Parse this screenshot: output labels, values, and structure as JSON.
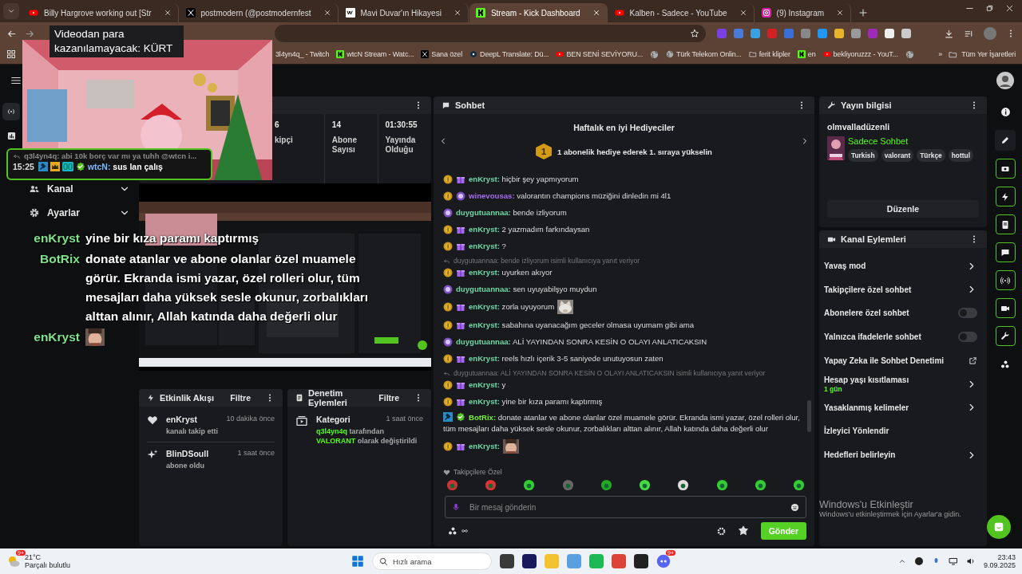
{
  "browser": {
    "tabs": [
      {
        "title": "Billy Hargrove working out [Str",
        "kind": "youtube",
        "selected": false
      },
      {
        "title": "postmodern (@postmodernfest",
        "kind": "x",
        "selected": false
      },
      {
        "title": "Mavi Duvar'ın Hikayesi",
        "kind": "wa",
        "selected": false
      },
      {
        "title": "Stream - Kick Dashboard",
        "kind": "kick",
        "selected": true
      },
      {
        "title": "Kalben - Sadece - YouTube",
        "kind": "youtube",
        "selected": false
      },
      {
        "title": "(9) Instagram",
        "kind": "instagram",
        "selected": false
      }
    ],
    "bookmarks": [
      {
        "label": "3l4yn4q_ - Twitch",
        "kind": "none"
      },
      {
        "label": "wtcN Stream - Watc...",
        "kind": "kick"
      },
      {
        "label": "Sana özel",
        "kind": "x"
      },
      {
        "label": "DeepL Translate: Dü...",
        "kind": "deepl"
      },
      {
        "label": "BEN SENİ SEVİYORU...",
        "kind": "youtube"
      },
      {
        "kind": "globe"
      },
      {
        "label": "Türk Telekom Onlin...",
        "kind": "globe"
      },
      {
        "label": "ferit klipler",
        "kind": "folder"
      },
      {
        "label": "en",
        "kind": "kick"
      },
      {
        "label": "bekliyoruzzz - YouT...",
        "kind": "youtube"
      },
      {
        "kind": "globe"
      }
    ],
    "more": "»",
    "all_bookmarks": "Tüm Yer İşaretleri"
  },
  "sidebar": {
    "items": [
      {
        "label": "Kanal",
        "kind": "users",
        "expanded": false
      },
      {
        "label": "Ayarlar",
        "kind": "gear",
        "expanded": false
      }
    ]
  },
  "stats": [
    {
      "value": "6",
      "label": "kipçi"
    },
    {
      "value": "14",
      "label": "Abone Sayısı"
    },
    {
      "value": "01:30:55",
      "label": "Yayında Olduğu"
    }
  ],
  "activity": {
    "title": "Etkinlik Akışı",
    "filter": "Filtre",
    "items": [
      {
        "kind": "follow",
        "user": "enKryst",
        "action": "kanalı takip etti",
        "time": "10 dakika önce"
      },
      {
        "kind": "sub",
        "user": "BlinDSoull",
        "action": "abone oldu",
        "time": "1 saat önce"
      }
    ]
  },
  "moderation": {
    "title": "Denetim Eylemleri",
    "filter": "Filtre",
    "items": [
      {
        "title": "Kategori",
        "time": "1 saat önce",
        "parts": [
          {
            "text": "q3l4yn4q ",
            "highlight": true
          },
          {
            "text": "tarafından ",
            "highlight": false
          },
          {
            "text": "VALORANT ",
            "highlight": true
          },
          {
            "text": "olarak değiştirildi",
            "highlight": false
          }
        ]
      }
    ]
  },
  "chat": {
    "title": "Sohbet",
    "gifters_title": "Haftalık en iyi Hediyeciler",
    "rank": "1",
    "gifters_text": "1 abonelik hediye ederek 1. sıraya yükselin",
    "messages": [
      {
        "badges": [
          {
            "kind": "sub"
          },
          {
            "kind": "gift"
          }
        ],
        "user": "enKryst:",
        "color": "#6fd6a6",
        "text": " hiçbir şey yapmıyorum"
      },
      {
        "badges": [
          {
            "kind": "sub"
          },
          {
            "kind": "avatar"
          }
        ],
        "user": "winevousas:",
        "color": "#a66bf0",
        "text": " valorantın champions müziğini dinledin mi 4l1"
      },
      {
        "badges": [
          {
            "kind": "avatar"
          }
        ],
        "user": "duygutuannaa:",
        "color": "#6fd6a6",
        "text": " bende izliyorum"
      },
      {
        "badges": [
          {
            "kind": "sub"
          },
          {
            "kind": "gift"
          }
        ],
        "user": "enKryst:",
        "color": "#6fd6a6",
        "text": " 2 yazmadım farkındaysan"
      },
      {
        "badges": [
          {
            "kind": "sub"
          },
          {
            "kind": "gift"
          }
        ],
        "user": "enKryst:",
        "color": "#6fd6a6",
        "text": " ?"
      },
      {
        "reply": "duygutuannaa: bende izliyorum isimli kullanıcıya yanıt veriyor",
        "badges": [
          {
            "kind": "sub"
          },
          {
            "kind": "gift"
          }
        ],
        "user": "enKryst:",
        "color": "#6fd6a6",
        "text": " uyurken akıyor"
      },
      {
        "badges": [
          {
            "kind": "avatar"
          }
        ],
        "user": "duygutuannaa:",
        "color": "#6fd6a6",
        "text": " sen uyuyabilşyo muydun"
      },
      {
        "badges": [
          {
            "kind": "sub"
          },
          {
            "kind": "gift"
          }
        ],
        "user": "enKryst:",
        "color": "#6fd6a6",
        "text": " zorla uyuyorum",
        "emote": true
      },
      {
        "badges": [
          {
            "kind": "sub"
          },
          {
            "kind": "gift"
          }
        ],
        "user": "enKryst:",
        "color": "#6fd6a6",
        "text": " sabahına uyanacağım geceler olmasa uyumam gibi ama"
      },
      {
        "badges": [
          {
            "kind": "avatar"
          }
        ],
        "user": "duygutuannaa:",
        "color": "#6fd6a6",
        "text": " ALİ YAYINDAN SONRA KESİN O OLAYI ANLATICAKSIN"
      },
      {
        "badges": [
          {
            "kind": "sub"
          },
          {
            "kind": "gift"
          }
        ],
        "user": "enKryst:",
        "color": "#6fd6a6",
        "text": " reels hızlı içerik 3-5 saniyede unutuyosun zaten"
      },
      {
        "reply": "duygutuannaa: ALİ YAYINDAN SONRA KESİN O OLAYI ANLATICAKSIN isimli kullanıcıya yanıt veriyor",
        "badges": [
          {
            "kind": "sub"
          },
          {
            "kind": "gift"
          }
        ],
        "user": "enKryst:",
        "color": "#6fd6a6",
        "text": " y"
      },
      {
        "badges": [
          {
            "kind": "sub"
          },
          {
            "kind": "gift"
          }
        ],
        "user": "enKryst:",
        "color": "#6fd6a6",
        "text": " yine bir kıza paramı kaptırmış"
      },
      {
        "badges": [
          {
            "kind": "mod"
          },
          {
            "kind": "verified"
          }
        ],
        "user": "BotRix:",
        "color": "#72f03c",
        "text": " donate atanlar ve abone olanlar özel muamele görür. Ekranda ismi yazar, özel rolleri olur, tüm mesajları daha yüksek sesle okunur, zorbalıkları alttan alınır, Allah katında daha değerli olur"
      },
      {
        "badges": [
          {
            "kind": "sub"
          },
          {
            "kind": "gift"
          }
        ],
        "user": "enKryst:",
        "color": "#6fd6a6",
        "emote": true
      }
    ],
    "emote_label": "Takipçilere Özel",
    "placeholder": "Bir mesaj gönderin",
    "send": "Gönder"
  },
  "stream_info": {
    "title": "Yayın bilgisi",
    "channel": "olmvalladüzenli",
    "category": "Sadece Sohbet",
    "tags": [
      "Turkish",
      "valorant",
      "Türkçe",
      "hottul"
    ],
    "button": "Düzenle"
  },
  "channel_actions": {
    "title": "Kanal Eylemleri",
    "items": [
      {
        "label": "Yavaş mod",
        "kind": "chevron"
      },
      {
        "label": "Takipçilere özel sohbet",
        "kind": "chevron"
      },
      {
        "label": "Abonelere özel sohbet",
        "kind": "toggle",
        "on": false
      },
      {
        "label": "Yalnızca ifadelerle sohbet",
        "kind": "toggle",
        "on": false
      },
      {
        "label": "Yapay Zeka ile Sohbet Denetimi",
        "kind": "external"
      },
      {
        "label": "Hesap yaşı kısıtlaması",
        "sub": "1 gün",
        "kind": "chevron"
      },
      {
        "label": "Yasaklanmış kelimeler",
        "kind": "chevron"
      },
      {
        "label": "İzleyici Yönlendir",
        "kind": "plain"
      },
      {
        "label": "Hedefleri belirleyin",
        "kind": "chevron"
      }
    ]
  },
  "stream_overlay": {
    "caption": "Videodan para kazanılamayacak: KÜRT",
    "reply": "q3l4yn4q: abi 10k borç var mı ya tuhh @wtcn i...",
    "time": "15:25",
    "user": "wtcN:",
    "text": " sus lan çalış"
  },
  "tts_overlay": [
    {
      "user": "enKryst",
      "text": "yine bir kıza paramı kaptırmış"
    },
    {
      "user": "BotRix",
      "text": "donate atanlar ve abone olanlar özel muamele görür. Ekranda ismi yazar, özel rolleri olur, tüm mesajları daha yüksek sesle okunur, zorbalıkları alttan alınır, Allah katında daha değerli olur"
    },
    {
      "user": "enKryst",
      "emote": true
    }
  ],
  "activation": {
    "title": "Windows'u Etkinleştir",
    "text": "Windows'u etkinleştirmek için Ayarlar'a gidin."
  },
  "taskbar": {
    "weather_badge": "9+",
    "temp": "21°C",
    "desc": "Parçalı bulutlu",
    "search": "Hızlı arama",
    "discord_badge": "9+",
    "time": "23:43",
    "date": "9.09.2025"
  }
}
